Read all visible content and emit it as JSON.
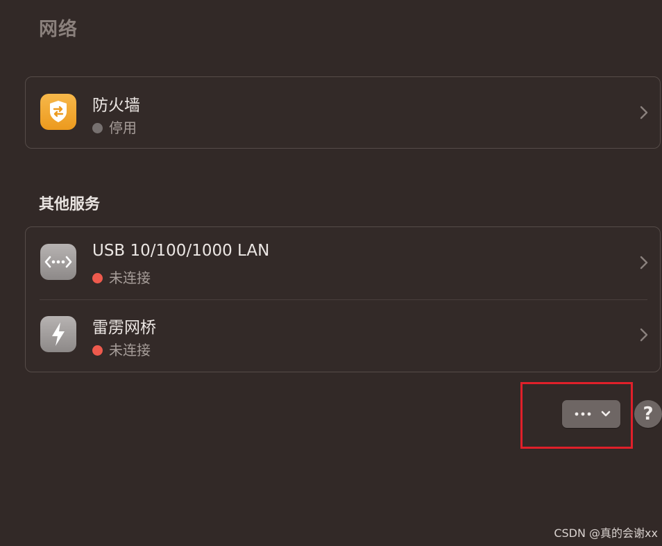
{
  "page": {
    "title": "网络"
  },
  "firewall": {
    "title": "防火墙",
    "status": "停用",
    "icon": "firewall-shield-icon"
  },
  "other_services": {
    "heading": "其他服务",
    "items": [
      {
        "title": "USB 10/100/1000 LAN",
        "status": "未连接",
        "icon": "ethernet-icon"
      },
      {
        "title": "雷雳网桥",
        "status": "未连接",
        "icon": "thunderbolt-icon"
      }
    ]
  },
  "actions": {
    "more_label": "•••",
    "help_label": "?"
  },
  "watermark": "CSDN @真的会谢xx",
  "colors": {
    "background": "#322927",
    "status_disabled": "#777170",
    "status_disconnected": "#ee5a4d",
    "firewall_icon": "#f2a52e",
    "highlight": "#e0202a"
  }
}
